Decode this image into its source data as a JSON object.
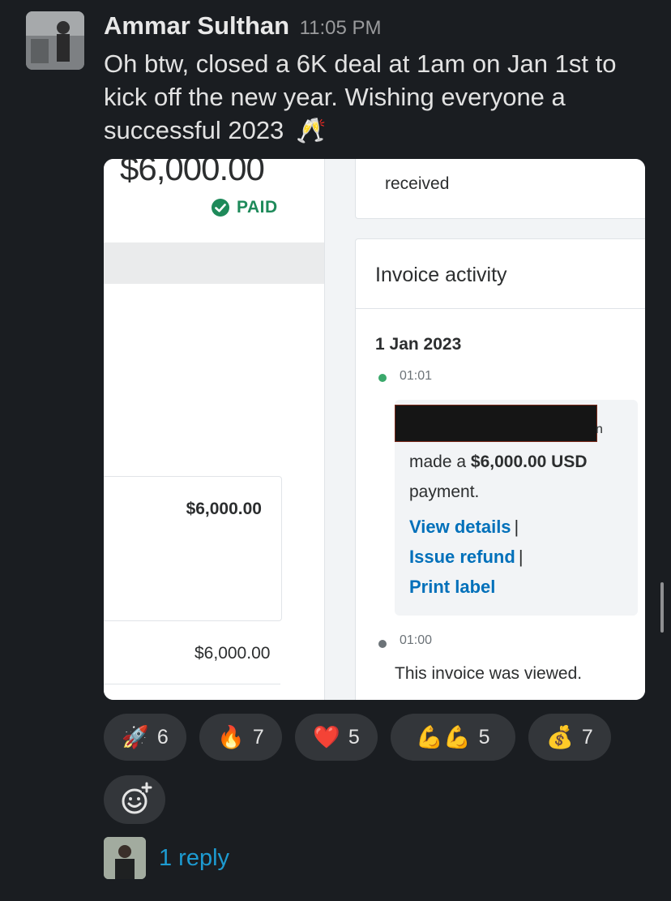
{
  "message": {
    "author": "Ammar Sulthan",
    "timestamp": "11:05 PM",
    "text": "Oh btw, closed a 6K deal at 1am on Jan 1st to kick off the new year. Wishing everyone a successful 2023",
    "text_emoji": "🥂"
  },
  "attachment": {
    "big_amount": "$6,000.00",
    "status": "PAID",
    "amount_box_value": "$6,000.00",
    "amount_bottom": "$6,000.00",
    "top_card_text": "received",
    "activity": {
      "title": "Invoice activity",
      "date": "1 Jan 2023",
      "event1_time": "01:01",
      "event1_redaction_tail": "n",
      "event1_text_pre": "made a ",
      "event1_amount": "$6,000.00 USD",
      "event1_text_post": "payment.",
      "links": [
        "View details",
        "Issue refund",
        "Print label"
      ],
      "link_separator": "|",
      "event2_time": "01:00",
      "event2_text": "This invoice was viewed."
    }
  },
  "reactions": [
    {
      "emoji": "🚀",
      "count": "6"
    },
    {
      "emoji": "🔥",
      "count": "7"
    },
    {
      "emoji": "❤️",
      "count": "5"
    },
    {
      "emoji": "💪💪",
      "count": "5"
    },
    {
      "emoji": "💰",
      "count": "7"
    }
  ],
  "thread": {
    "reply_text": "1 reply"
  },
  "colors": {
    "background": "#1a1d21",
    "link_blue": "#1d9bd1",
    "paypal_blue": "#0070ba",
    "paid_green": "#1e8a5a"
  },
  "icons": {
    "add_reaction": "smiley-plus-icon",
    "paid": "check-circle-icon"
  }
}
